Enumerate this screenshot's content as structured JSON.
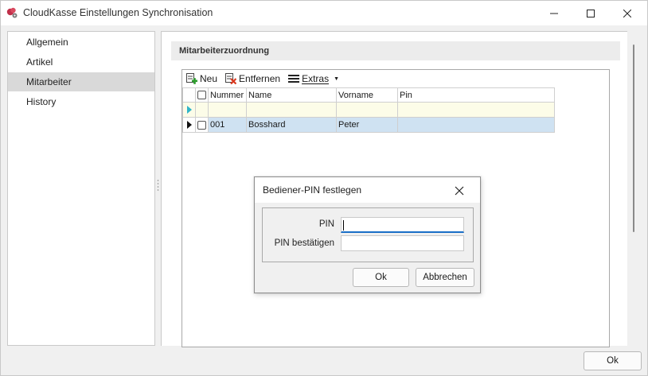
{
  "window": {
    "title": "CloudKasse Einstellungen Synchronisation"
  },
  "nav": {
    "items": [
      {
        "label": "Allgemein",
        "selected": false
      },
      {
        "label": "Artikel",
        "selected": false
      },
      {
        "label": "Mitarbeiter",
        "selected": true
      },
      {
        "label": "History",
        "selected": false
      }
    ]
  },
  "section": {
    "title": "Mitarbeiterzuordnung"
  },
  "toolbar": {
    "new_label": "Neu",
    "remove_label": "Entfernen",
    "extras_label": "Extras"
  },
  "grid": {
    "columns": [
      "Nummer",
      "Name",
      "Vorname",
      "Pin"
    ],
    "rows": [
      {
        "nummer": "001",
        "name": "Bosshard",
        "vorname": "Peter",
        "pin": ""
      }
    ]
  },
  "dialog": {
    "title": "Bediener-PIN festlegen",
    "pin_label": "PIN",
    "pin_value": "",
    "confirm_label": "PIN bestätigen",
    "confirm_value": "",
    "ok_label": "Ok",
    "cancel_label": "Abbrechen"
  },
  "footer": {
    "ok_label": "Ok"
  },
  "colors": {
    "selected_row": "#cfe2f2",
    "new_row": "#fcfce8",
    "focus_accent": "#1a6fc7",
    "add_icon": "#2e9d2e",
    "remove_icon": "#d9381e"
  }
}
